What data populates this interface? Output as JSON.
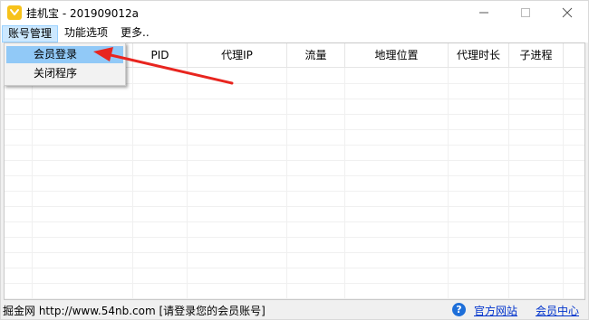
{
  "window": {
    "title": "挂机宝 - 201909012a"
  },
  "menubar": {
    "items": [
      {
        "label": "账号管理"
      },
      {
        "label": "功能选项"
      },
      {
        "label": "更多.."
      }
    ]
  },
  "dropdown": {
    "items": [
      {
        "label": "会员登录"
      },
      {
        "label": "关闭程序"
      }
    ]
  },
  "table": {
    "columns": [
      {
        "label": ""
      },
      {
        "label": ""
      },
      {
        "label": "PID"
      },
      {
        "label": "代理IP"
      },
      {
        "label": "流量"
      },
      {
        "label": "地理位置"
      },
      {
        "label": "代理时长"
      },
      {
        "label": "子进程"
      }
    ],
    "rows": []
  },
  "statusbar": {
    "text": "掘金网 http://www.54nb.com [请登录您的会员账号]",
    "links": [
      {
        "label": "官方网站"
      },
      {
        "label": "会员中心"
      }
    ]
  },
  "annotation": {
    "arrow_color": "#e8251f"
  }
}
